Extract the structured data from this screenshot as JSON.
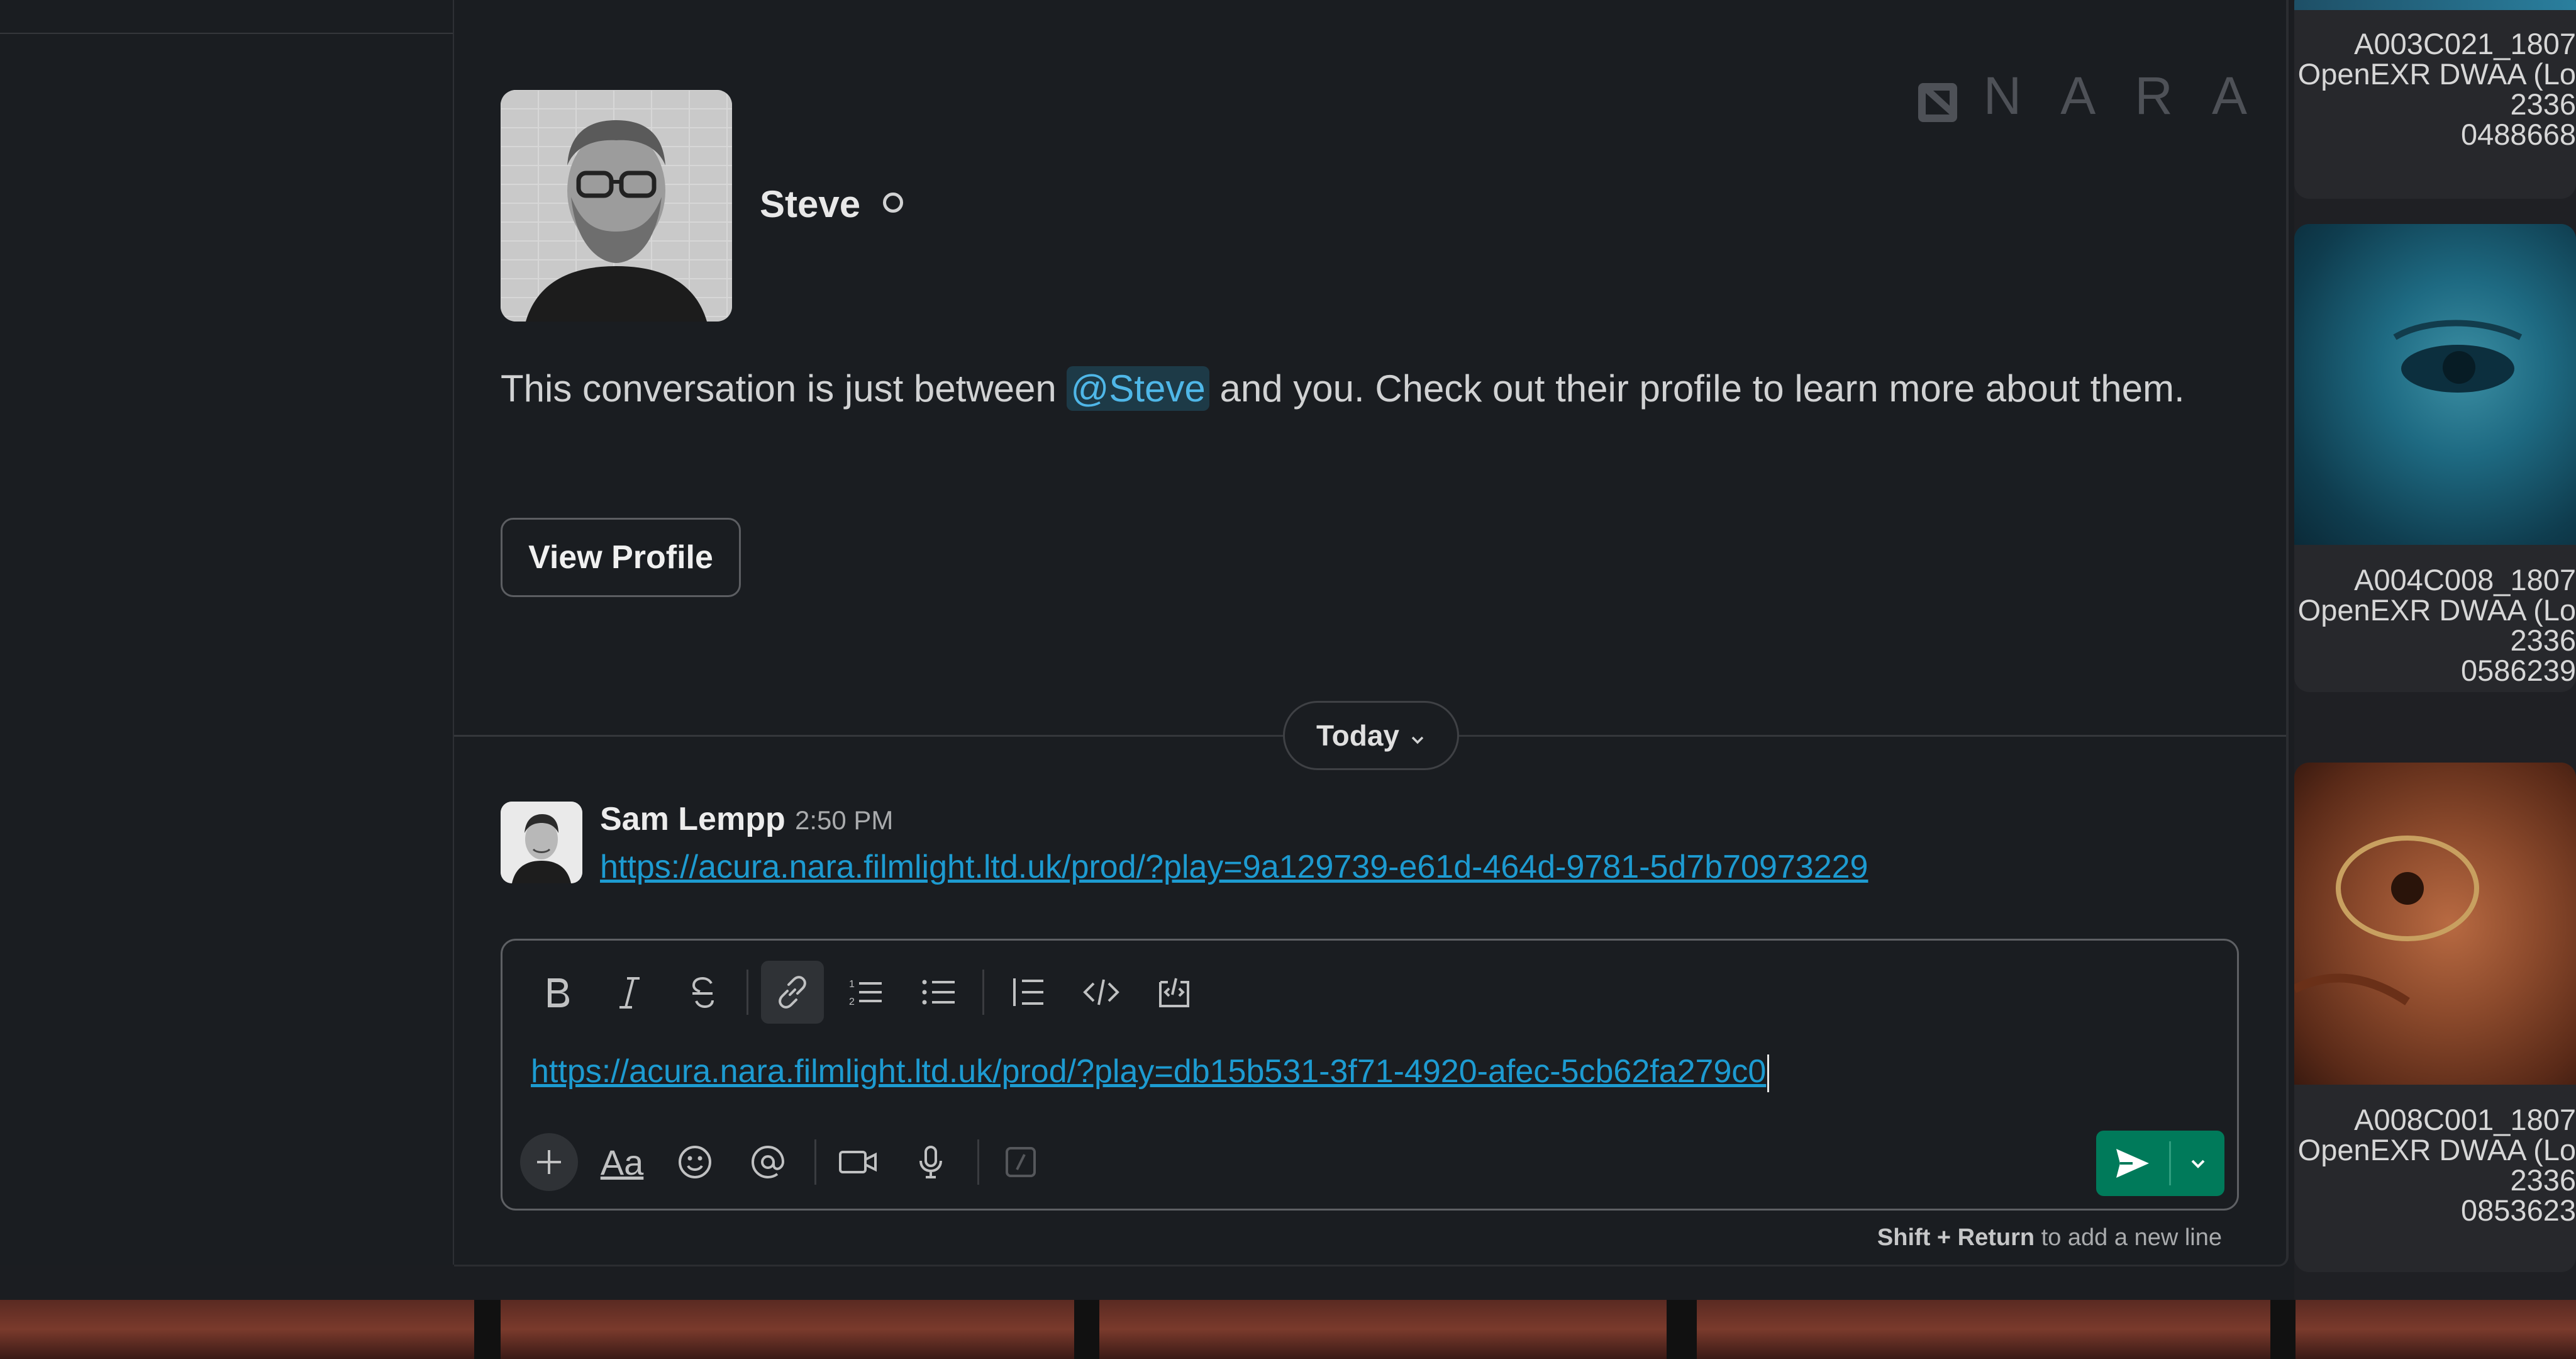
{
  "watermark": {
    "text": "NARA"
  },
  "profile": {
    "name": "Steve",
    "intro_before": "This conversation is just between ",
    "mention": "@Steve",
    "intro_after": " and you. Check out their profile to learn more about them.",
    "view_profile_label": "View Profile"
  },
  "date_divider": {
    "label": "Today"
  },
  "message": {
    "author": "Sam Lempp",
    "time": "2:50 PM",
    "link": "https://acura.nara.filmlight.ltd.uk/prod/?play=9a129739-e61d-464d-9781-5d7b70973229"
  },
  "composer": {
    "value": "https://acura.nara.filmlight.ltd.uk/prod/?play=db15b531-3f71-4920-afec-5cb62fa279c0",
    "format_label": "Aa",
    "hint_bold": "Shift + Return",
    "hint_rest": " to add a new line"
  },
  "clips": [
    {
      "name": "A003C021_1807",
      "format": "OpenEXR DWAA (Lo",
      "frames": "2336",
      "id": "0488668"
    },
    {
      "name": "A004C008_1807",
      "format": "OpenEXR DWAA (Lo",
      "frames": "2336",
      "id": "0586239"
    },
    {
      "name": "A008C001_1807",
      "format": "OpenEXR DWAA (Lo",
      "frames": "2336",
      "id": "0853623"
    }
  ],
  "colors": {
    "accent_link": "#1d9bd1",
    "send_button": "#007a5a",
    "background": "#1a1d21"
  }
}
